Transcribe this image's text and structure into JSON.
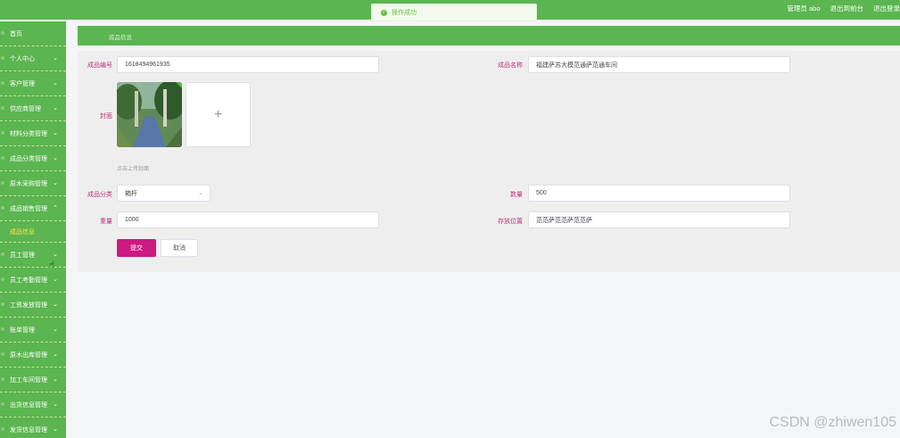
{
  "top_links": [
    "管理员 abo",
    "退出到前台",
    "退出登录"
  ],
  "toast": {
    "message": "操作成功"
  },
  "sidebar": {
    "items": [
      {
        "label": "首页",
        "chev": ""
      },
      {
        "label": "个人中心",
        "chev": "⌄"
      },
      {
        "label": "客户管理",
        "chev": "⌄"
      },
      {
        "label": "供应商管理",
        "chev": "⌄"
      },
      {
        "label": "材料分类管理",
        "chev": "⌄"
      },
      {
        "label": "成品分类管理",
        "chev": "⌄"
      },
      {
        "label": "原木采购管理",
        "chev": "⌄"
      },
      {
        "label": "成品销售管理",
        "chev": "⌃"
      },
      {
        "label": "成品信息",
        "chev": ""
      },
      {
        "label": "员工管理",
        "chev": "⌄"
      },
      {
        "label": "员工考勤管理",
        "chev": "⌄"
      },
      {
        "label": "工资发放管理",
        "chev": "⌄"
      },
      {
        "label": "账单管理",
        "chev": "⌄"
      },
      {
        "label": "原木出库管理",
        "chev": "⌄"
      },
      {
        "label": "加工车间管理",
        "chev": "⌄"
      },
      {
        "label": "出货信息管理",
        "chev": "⌄"
      },
      {
        "label": "发货信息管理",
        "chev": "⌄"
      }
    ]
  },
  "breadcrumb": "成品信息",
  "form": {
    "code_label": "成品编号",
    "code_value": "1618494961935",
    "name_label": "成品名称",
    "name_value": "福建萨苏大模范通萨范通车间",
    "cover_label": "封面",
    "upload_tip": "点击上传封面",
    "category_label": "成品分类",
    "category_value": "箱杆",
    "quantity_label": "数量",
    "quantity_value": "500",
    "weight_label": "重量",
    "weight_value": "1000",
    "location_label": "存放位置",
    "location_value": "范范萨范范萨范范萨",
    "submit_label": "提交",
    "cancel_label": "取消"
  },
  "watermark": "CSDN @zhiwen105"
}
